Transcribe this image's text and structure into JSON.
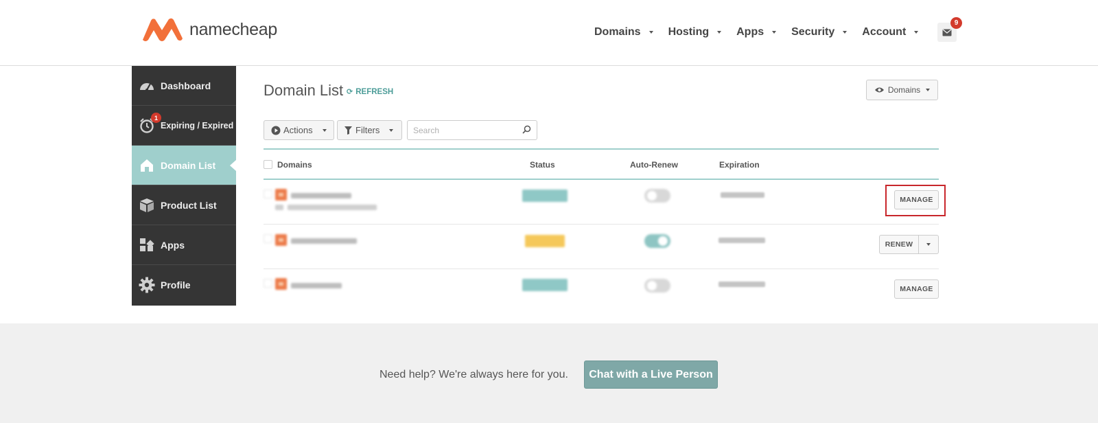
{
  "header": {
    "brand": "namecheap",
    "brand_colors": {
      "mark": "#f2703a",
      "text": "#444444"
    },
    "nav": [
      {
        "label": "Domains"
      },
      {
        "label": "Hosting"
      },
      {
        "label": "Apps"
      },
      {
        "label": "Security"
      },
      {
        "label": "Account"
      }
    ],
    "mail_count": "9"
  },
  "sidebar": {
    "items": [
      {
        "label": "Dashboard",
        "icon": "gauge-icon"
      },
      {
        "label": "Expiring / Expired",
        "icon": "alarm-clock-icon",
        "badge": "1"
      },
      {
        "label": "Domain List",
        "icon": "home-icon",
        "active": true
      },
      {
        "label": "Product List",
        "icon": "box-icon"
      },
      {
        "label": "Apps",
        "icon": "apps-grid-icon"
      },
      {
        "label": "Profile",
        "icon": "gear-icon"
      }
    ]
  },
  "main": {
    "title": "Domain List",
    "refresh_label": "REFRESH",
    "view_selector": "Domains",
    "toolbar": {
      "actions_label": "Actions",
      "filters_label": "Filters",
      "search_placeholder": "Search"
    },
    "table": {
      "columns": [
        "Domains",
        "Status",
        "Auto-Renew",
        "Expiration"
      ],
      "rows": [
        {
          "status_color": "#8fc8c6",
          "auto_renew": false,
          "action": "MANAGE",
          "highlighted": true
        },
        {
          "status_color": "#f5c85a",
          "auto_renew": true,
          "action": "RENEW"
        },
        {
          "status_color": "#8fc8c6",
          "auto_renew": false,
          "action": "MANAGE"
        }
      ]
    }
  },
  "footer": {
    "help_text": "Need help? We're always here for you.",
    "chat_button": "Chat with a Live Person"
  },
  "colors": {
    "accent": "#9fcfcc",
    "sidebar_bg": "#353535",
    "badge": "#d33a2c",
    "highlight": "#c8262b",
    "chat_button": "#7fa8a7"
  }
}
